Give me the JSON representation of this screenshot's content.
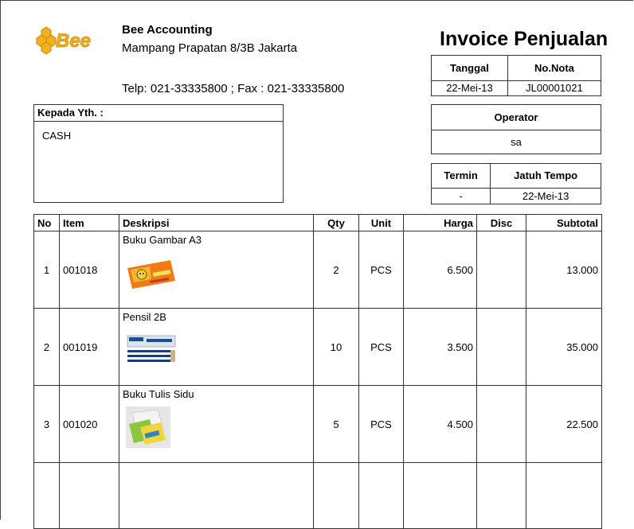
{
  "company": {
    "name": "Bee Accounting",
    "address": "Mampang Prapatan 8/3B Jakarta",
    "phone": "Telp: 021-33335800 ; Fax : 021-33335800",
    "logo_text": "Bee",
    "brand_color": "#f2b01e"
  },
  "document": {
    "title": "Invoice Penjualan"
  },
  "meta": {
    "date_label": "Tanggal",
    "date_value": "22-Mei-13",
    "number_label": "No.Nota",
    "number_value": "JL00001021",
    "operator_label": "Operator",
    "operator_value": "sa",
    "terms_label": "Termin",
    "terms_value": "-",
    "due_label": "Jatuh Tempo",
    "due_value": "22-Mei-13"
  },
  "recipient": {
    "label": "Kepada Yth.  :",
    "value": "CASH"
  },
  "items_table": {
    "headers": {
      "no": "No",
      "item": "Item",
      "desc": "Deskripsi",
      "qty": "Qty",
      "unit": "Unit",
      "price": "Harga",
      "disc": "Disc",
      "subtotal": "Subtotal"
    },
    "rows": [
      {
        "no": "1",
        "item": "001018",
        "desc": "Buku Gambar A3",
        "qty": "2",
        "unit": "PCS",
        "price": "6.500",
        "disc": "",
        "subtotal": "13.000",
        "image_icon": "drawing-book-image"
      },
      {
        "no": "2",
        "item": "001019",
        "desc": "Pensil 2B",
        "qty": "10",
        "unit": "PCS",
        "price": "3.500",
        "disc": "",
        "subtotal": "35.000",
        "image_icon": "pencil-box-image"
      },
      {
        "no": "3",
        "item": "001020",
        "desc": "Buku Tulis Sidu",
        "qty": "5",
        "unit": "PCS",
        "price": "4.500",
        "disc": "",
        "subtotal": "22.500",
        "image_icon": "notebook-image"
      }
    ]
  }
}
